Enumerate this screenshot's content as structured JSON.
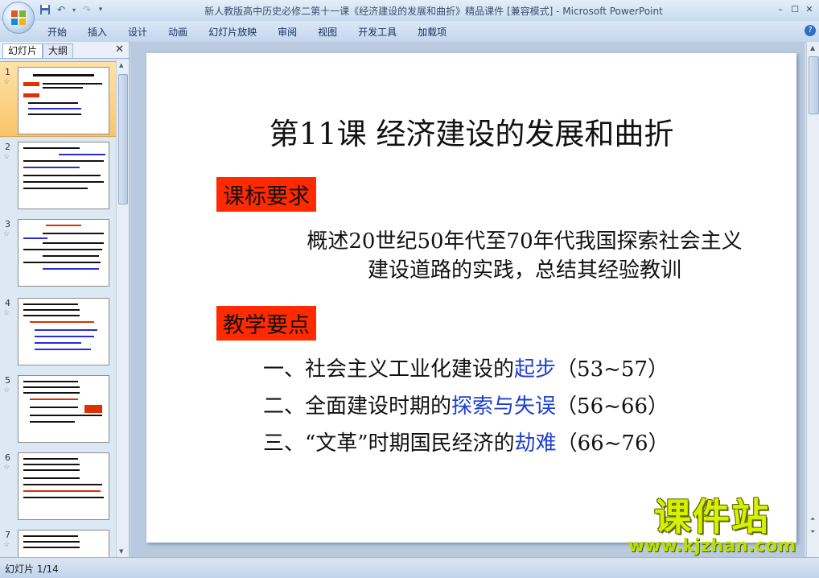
{
  "window": {
    "title": "新人教版高中历史必修二第十一课《经济建设的发展和曲折》精品课件 [兼容模式] - Microsoft PowerPoint"
  },
  "ribbon": {
    "tabs": [
      "开始",
      "插入",
      "设计",
      "动画",
      "幻灯片放映",
      "审阅",
      "视图",
      "开发工具",
      "加载项"
    ]
  },
  "panel": {
    "tab_slides": "幻灯片",
    "tab_outline": "大纲",
    "thumbnails": [
      {
        "num": "1"
      },
      {
        "num": "2"
      },
      {
        "num": "3"
      },
      {
        "num": "4"
      },
      {
        "num": "5"
      },
      {
        "num": "6"
      },
      {
        "num": "7"
      }
    ]
  },
  "slide": {
    "title": "第11课  经济建设的发展和曲折",
    "label1": "课标要求",
    "requirement_line1": "概述20世纪50年代至70年代我国探索社会主义",
    "requirement_line2": "建设道路的实践，总结其经验教训",
    "label2": "教学要点",
    "points": [
      {
        "pre": "一、社会主义工业化建设的",
        "hl": "起步",
        "post": "（53~57）"
      },
      {
        "pre": "二、全面建设时期的",
        "hl": "探索与失误",
        "post": "（56~66）"
      },
      {
        "pre": "三、“文革”时期国民经济的",
        "hl": "劫难",
        "post": "（66~76）"
      }
    ]
  },
  "watermark": {
    "main": "课件站",
    "url": "www.kjzhan.com"
  },
  "status": {
    "slide_counter": "幻灯片 1/14"
  },
  "colors": {
    "label_bg": "#ff2a00",
    "highlight_text": "#1f3fd0",
    "selected_thumb": "#fbc46b"
  }
}
